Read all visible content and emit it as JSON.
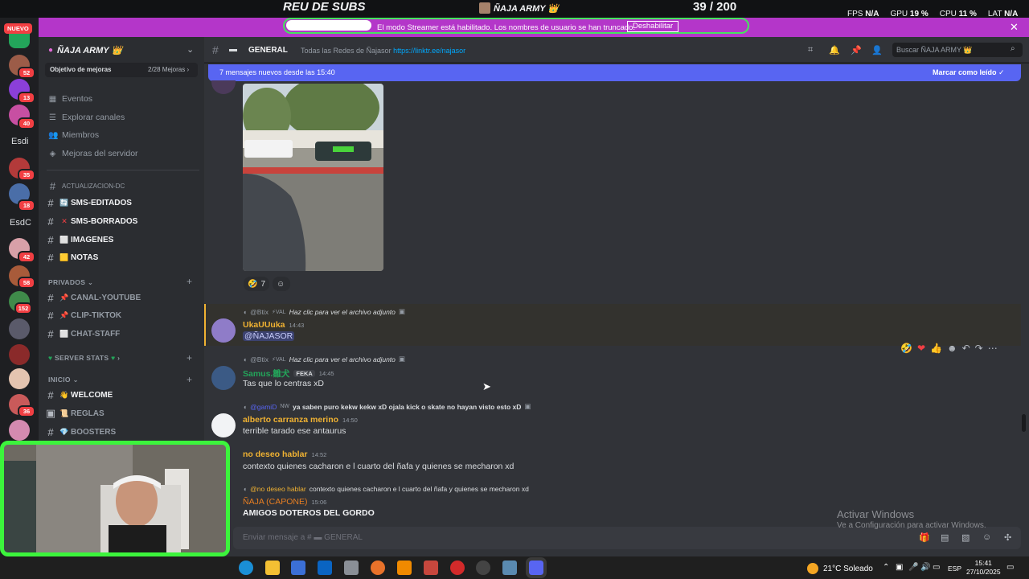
{
  "overlay": {
    "title": "REU DE SUBS",
    "streamer_name": "ÑAJA ARMY 👑",
    "counter": "39 / 200",
    "stats": [
      {
        "label": "FPS",
        "value": "N/A"
      },
      {
        "label": "GPU",
        "value": "19 %"
      },
      {
        "label": "CPU",
        "value": "11 %"
      },
      {
        "label": "LAT",
        "value": "N/A"
      }
    ]
  },
  "streamer_bar": {
    "text": "El modo Streamer está habilitado. Los nombres de usuario se han truncado.",
    "button": "Deshabilitar",
    "close": "✕"
  },
  "rail": {
    "nuevo": "NUEVO",
    "badges": [
      "52",
      "13",
      "40",
      "35",
      "18",
      "42",
      "58",
      "152",
      "36"
    ],
    "text_items": [
      "Esdi",
      "EsdC"
    ]
  },
  "sidebar": {
    "server_name": "ÑAJA ARMY 👑",
    "boost_label": "Objetivo de mejoras",
    "boost_count": "2/28 Mejoras ›",
    "links": [
      "Eventos",
      "Explorar canales",
      "Miembros",
      "Mejoras del servidor"
    ],
    "categories": {
      "actualizacion": "ACTUALIZACION-DC",
      "privados": "PRIVADOS",
      "server_stats": "SERVER STATS",
      "inicio": "INICIO"
    },
    "channels_a": [
      {
        "emoji": "🔄",
        "name": "SMS-EDITADOS"
      },
      {
        "emoji": "✕",
        "name": "SMS-BORRADOS"
      },
      {
        "emoji": "⬜",
        "name": "IMAGENES"
      },
      {
        "emoji": "🟨",
        "name": "NOTAS"
      }
    ],
    "channels_b": [
      {
        "emoji": "📌",
        "name": "CANAL-YOUTUBE"
      },
      {
        "emoji": "📌",
        "name": "CLIP-TIKTOK"
      },
      {
        "emoji": "⬜",
        "name": "CHAT-STAFF"
      }
    ],
    "channels_c": [
      {
        "emoji": "👋",
        "name": "WELCOME"
      },
      {
        "emoji": "📜",
        "name": "REGLAS"
      },
      {
        "emoji": "💎",
        "name": "BOOSTERS"
      }
    ]
  },
  "header": {
    "channel": "GENERAL",
    "topic": "Todas las Redes de Ñajasor",
    "link": "https://linktr.ee/najasor",
    "search_placeholder": "Buscar ÑAJA ARMY 👑"
  },
  "chat": {
    "new_messages": "7 mensajes nuevos desde las 15:40",
    "mark_read": "Marcar como leído",
    "reactions": [
      {
        "emoji": "🤣",
        "count": "7"
      }
    ],
    "messages": [
      {
        "reply_user": "@Btix",
        "reply_tag": "⚡VAL",
        "reply_text": "Haz clic para ver el archivo adjunto",
        "author": "UkaUUuka",
        "author_color": "#f0b232",
        "time": "14:43",
        "text": "@ÑAJASOR"
      },
      {
        "reply_user": "@Btix",
        "reply_tag": "⚡VAL",
        "reply_text": "Haz clic para ver el archivo adjunto",
        "author": "Samus.雛犬",
        "author_color": "#23a55a",
        "author_tag": "FEKA",
        "time": "14:45",
        "text": "Tas que lo centras xD"
      },
      {
        "reply_user": "@gamiD",
        "reply_tag": "NW",
        "reply_text": "ya saben puro kekw kekw xD ojala kick o skate no hayan visto esto xD",
        "author": "alberto carranza merino",
        "author_color": "#f0b232",
        "time": "14:50",
        "text": "terrible tarado ese antaurus"
      },
      {
        "author": "no deseo hablar",
        "author_color": "#f0b232",
        "time": "14:52",
        "text": "contexto quienes cacharon e l cuarto del ñafa y quienes se mecharon xd"
      },
      {
        "reply_user": "@no deseo hablar",
        "reply_text": "contexto quienes cacharon e l cuarto del ñafa y quienes se mecharon xd",
        "author": "ÑAJA (CAPONE)",
        "author_color": "#e67e22",
        "time": "15:06",
        "text": "AMIGOS DOTEROS DEL GORDO"
      }
    ]
  },
  "composer": {
    "placeholder": "Enviar mensaje a #",
    "channel": "GENERAL"
  },
  "watermark": {
    "line1": "Activar Windows",
    "line2": "Ve a Configuración para activar Windows."
  },
  "taskbar": {
    "weather": "21°C  Soleado",
    "lang": "ESP",
    "time": "15:41",
    "date": "27/10/2025"
  }
}
